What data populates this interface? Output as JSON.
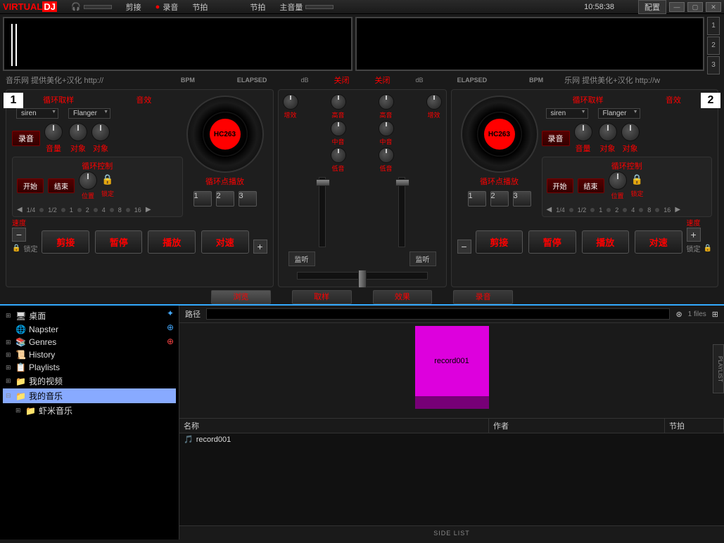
{
  "titlebar": {
    "logo_virtual": "VIRTUAL",
    "logo_dj": "DJ",
    "cut": "剪接",
    "record": "录音",
    "beat": "节拍",
    "beat2": "节拍",
    "master_vol": "主音量",
    "time": "10:58:38",
    "config": "配置"
  },
  "wave": {
    "n1": "1",
    "n2": "2",
    "n3": "3"
  },
  "info": {
    "left_txt": "音乐网 提供美化+汉化 http://",
    "right_txt": "乐网 提供美化+汉化 http://w",
    "bpm": "BPM",
    "elapsed": "ELAPSED",
    "db": "dB",
    "kill": "关闭"
  },
  "deck": {
    "num1": "1",
    "num2": "2",
    "loop_sample": "循环取样",
    "fx": "音效",
    "siren": "siren",
    "flanger": "Flanger",
    "rec": "录音",
    "vol": "音量",
    "target": "对象",
    "tt": "HC263",
    "loop_ctrl": "循环控制",
    "start": "开始",
    "end": "结束",
    "pos": "位置",
    "lock": "锁定",
    "nums": [
      "1/4",
      "1/2",
      "1",
      "2",
      "4",
      "8",
      "16"
    ],
    "cue_title": "循环点播放",
    "cues": [
      "1",
      "2",
      "3"
    ],
    "speed": "速度",
    "lock2": "锁定",
    "cut": "剪接",
    "pause": "暂停",
    "play": "播放",
    "sync": "对速"
  },
  "mixer": {
    "gain": "增效",
    "high": "高音",
    "mid": "中音",
    "low": "低音",
    "pfl": "监听"
  },
  "tabs": {
    "browse": "浏览",
    "sample": "取样",
    "fx": "效果",
    "rec": "录音"
  },
  "tree": {
    "desktop": "桌面",
    "napster": "Napster",
    "genres": "Genres",
    "history": "History",
    "playlists": "Playlists",
    "myvideo": "我的视频",
    "mymusic": "我的音乐",
    "xiami": "虾米音乐"
  },
  "browser": {
    "path_lbl": "路径",
    "files": "1 files",
    "thumb_name": "record001",
    "col_name": "名称",
    "col_artist": "作者",
    "col_bpm": "节拍",
    "row1": "record001",
    "sidelist": "SIDE LIST",
    "playlist": "PLAYLIST"
  }
}
